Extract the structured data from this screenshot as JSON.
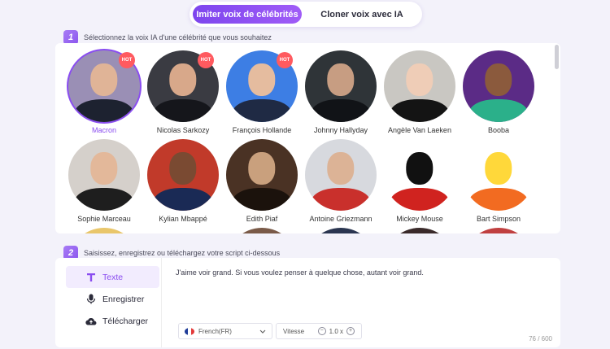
{
  "mode": {
    "active_label": "Imiter voix de célébrités",
    "other_label": "Cloner voix avec IA"
  },
  "step1": {
    "num": "1",
    "text": "Sélectionnez la voix IA d'une célébrité que vous souhaitez"
  },
  "celebs": [
    {
      "name": "Macron",
      "hot": "HOT",
      "bg": "#9a8fb5",
      "face": "#e0b497",
      "body": "#1d2230",
      "selected": true
    },
    {
      "name": "Nicolas Sarkozy",
      "hot": "HOT",
      "bg": "#3a3b42",
      "face": "#d8a88a",
      "body": "#15161b"
    },
    {
      "name": "François Hollande",
      "hot": "HOT",
      "bg": "#3d7ee4",
      "face": "#e5bc9f",
      "body": "#1f2a44"
    },
    {
      "name": "Johnny Hallyday",
      "hot": "",
      "bg": "#2f3438",
      "face": "#c79d82",
      "body": "#111317"
    },
    {
      "name": "Angèle Van Laeken",
      "hot": "",
      "bg": "#c9c7c2",
      "face": "#efcdb7",
      "body": "#141414"
    },
    {
      "name": "Booba",
      "hot": "",
      "bg": "#5b2b86",
      "face": "#8b5a3d",
      "body": "#2bb08a"
    },
    {
      "name": "Sophie Marceau",
      "hot": "",
      "bg": "#d5d0cb",
      "face": "#e3b89a",
      "body": "#1e1e1e"
    },
    {
      "name": "Kylian Mbappé",
      "hot": "",
      "bg": "#c13a2a",
      "face": "#7a4a32",
      "body": "#1a2a55"
    },
    {
      "name": "Edith Piaf",
      "hot": "",
      "bg": "#4a3224",
      "face": "#c9a07d",
      "body": "#1b120c"
    },
    {
      "name": "Antoine Griezmann",
      "hot": "",
      "bg": "#d7d9de",
      "face": "#dcb396",
      "body": "#c9302c"
    },
    {
      "name": "Mickey Mouse",
      "hot": "",
      "bg": "#ffffff",
      "face": "#111111",
      "body": "#d0231f"
    },
    {
      "name": "Bart Simpson",
      "hot": "",
      "bg": "#ffffff",
      "face": "#ffd83a",
      "body": "#f26b21"
    }
  ],
  "step2": {
    "num": "2",
    "text": "Saisissez, enregistrez ou téléchargez votre script ci-dessous"
  },
  "tabs": [
    {
      "label": "Texte",
      "icon": "text-icon"
    },
    {
      "label": "Enregistrer",
      "icon": "microphone-icon"
    },
    {
      "label": "Télécharger",
      "icon": "cloud-upload-icon"
    }
  ],
  "script": {
    "text": "J'aime voir grand. Si vous voulez penser à quelque chose, autant voir grand.",
    "language": "French(FR)",
    "speed_label": "Vitesse",
    "speed_value": "1.0 x",
    "counter": "76 / 600"
  },
  "colors": {
    "accent": "#8a4df0",
    "hot": "#ff5a5f",
    "background": "#f3f2fa"
  }
}
